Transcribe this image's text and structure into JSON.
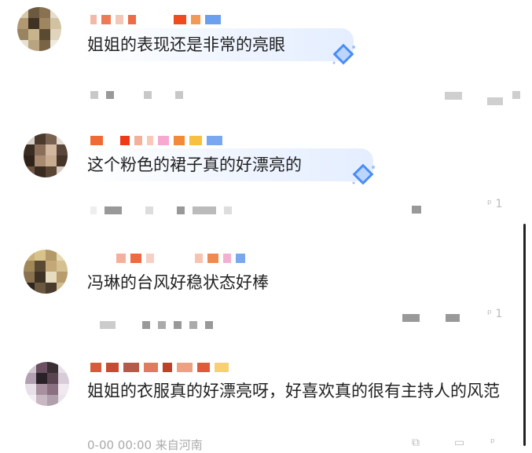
{
  "comments": [
    {
      "text": "姐姐的表现还是非常的亮眼",
      "badge_icon": "diamond-badge-icon"
    },
    {
      "text": "这个粉色的裙子真的好漂亮的",
      "badge_icon": "diamond-badge-icon"
    },
    {
      "text": "冯琳的台风好稳状态好棒"
    },
    {
      "text": "姐姐的衣服真的好漂亮呀，好喜欢真的很有主持人的风范"
    }
  ],
  "bottom_meta_text": "0-00 00:00  来自河南",
  "accent_colors": {
    "bubble_start": "#ffffff",
    "bubble_end": "#e4eeff",
    "diamond": "#4a8cf7"
  }
}
